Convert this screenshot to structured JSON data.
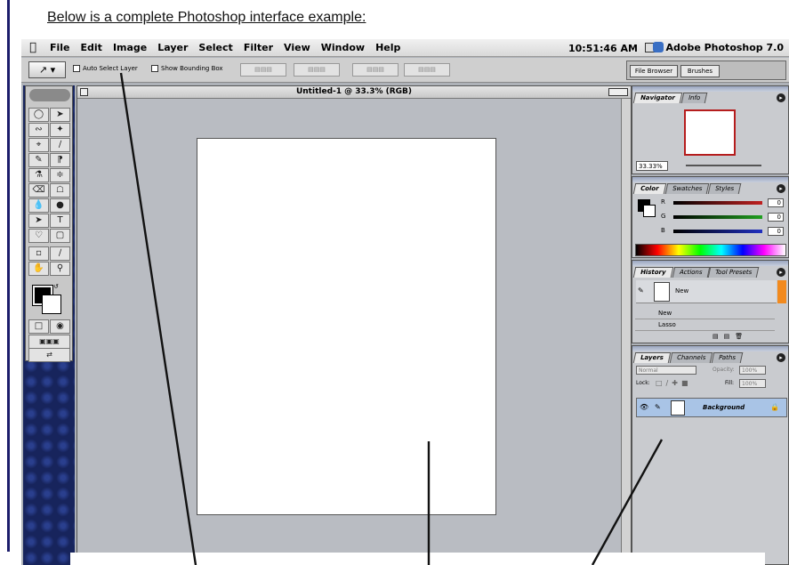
{
  "heading": "Below is a complete Photoshop interface example:",
  "menubar": {
    "items": [
      "File",
      "Edit",
      "Image",
      "Layer",
      "Select",
      "Filter",
      "View",
      "Window",
      "Help"
    ],
    "clock": "10:51:46 AM",
    "app_name": "Adobe Photoshop 7.0"
  },
  "options": {
    "auto_select": "Auto Select Layer",
    "show_bbox": "Show Bounding Box"
  },
  "palette_well": {
    "tabs": [
      "File Browser",
      "Brushes"
    ]
  },
  "document": {
    "title": "Untitled-1 @ 33.3% (RGB)"
  },
  "navigator": {
    "tabs": [
      "Navigator",
      "Info"
    ],
    "zoom": "33.33%"
  },
  "color": {
    "tabs": [
      "Color",
      "Swatches",
      "Styles"
    ],
    "channels": [
      {
        "label": "R",
        "value": "0",
        "color": "#c02020"
      },
      {
        "label": "G",
        "value": "0",
        "color": "#20a020"
      },
      {
        "label": "B",
        "value": "0",
        "color": "#2030c0"
      }
    ]
  },
  "history": {
    "tabs": [
      "History",
      "Actions",
      "Tool Presets"
    ],
    "snapshot": "New",
    "states": [
      "New",
      "Lasso"
    ]
  },
  "layers": {
    "tabs": [
      "Layers",
      "Channels",
      "Paths"
    ],
    "blend_mode": "Normal",
    "opacity_label": "Opacity:",
    "opacity": "100%",
    "lock_label": "Lock:",
    "fill_label": "Fill:",
    "fill": "100%",
    "layer_name": "Background"
  },
  "colors": {
    "accent_blue": "#1c1d6b",
    "layer_highlight": "#a9c4e6",
    "nav_frame": "#b51d1d"
  }
}
